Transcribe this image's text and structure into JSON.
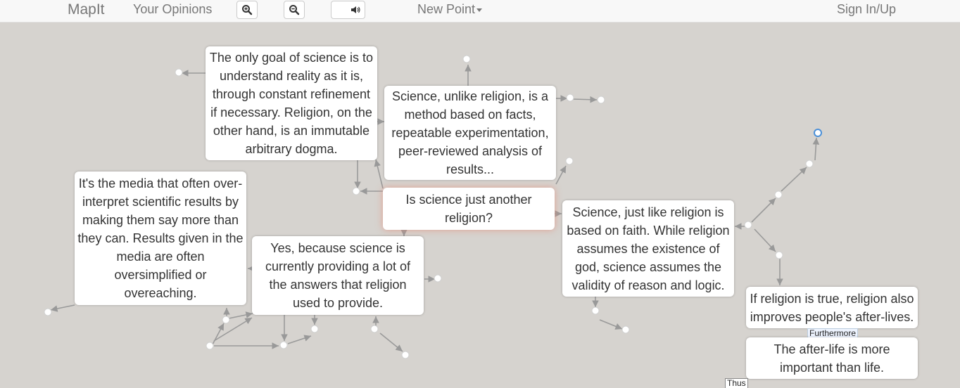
{
  "nav": {
    "brand": "MapIt",
    "your_opinions": "Your Opinions",
    "new_point": "New Point",
    "sign_in": "Sign In/Up"
  },
  "icons": {
    "zoom_in": "zoom-in-icon",
    "zoom_out": "zoom-out-icon",
    "sound": "speaker-icon"
  },
  "map": {
    "center_claim": "Is science just another religion?",
    "nodes": {
      "goal_of_science": "The only goal of science is to understand reality as it is, through constant refinement if necessary. Religion, on the other hand, is an immutable arbitrary dogma.",
      "science_method": "Science, unlike religion, is a method based on facts, repeatable experimentation, peer-reviewed analysis of results...",
      "media": "It's the media that often over-interpret scientific results by making them say more than they can. Results given in the media are often oversimplified or overeaching.",
      "yes_because": "Yes, because science is currently providing a lot of the answers that religion used to provide.",
      "faith": "Science, just like religion is based on faith. While religion assumes the existence of god, science assumes the validity of reason and logic.",
      "after_lives": "If religion is true, religion also improves people's after-lives.",
      "after_life_important": "The after-life is more important than life."
    },
    "connectors": {
      "furthermore": "Furthermore",
      "thus": "Thus"
    }
  },
  "colors": {
    "map_background": "#d6d3cf",
    "navbar": "#f8f8f8",
    "edge": "#999999",
    "selected_dot": "#4a8fd8"
  }
}
